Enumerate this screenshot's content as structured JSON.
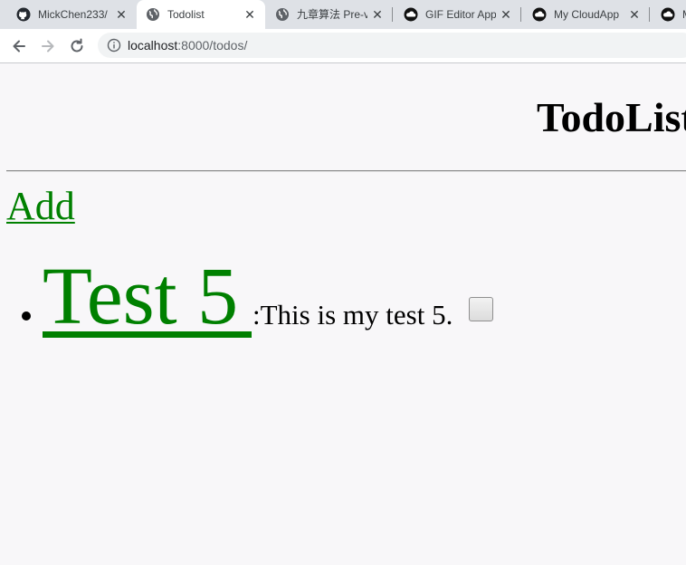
{
  "browser": {
    "tabs": [
      {
        "title": "MickChen233/",
        "icon": "github-icon"
      },
      {
        "title": "Todolist",
        "icon": "globe-icon",
        "active": true
      },
      {
        "title": "九章算法 Pre-v",
        "icon": "globe-icon"
      },
      {
        "title": "GIF Editor App",
        "icon": "cloud-icon"
      },
      {
        "title": "My CloudApp",
        "icon": "cloud-icon"
      },
      {
        "title": "M",
        "icon": "cloud-icon"
      }
    ],
    "url_host": "localhost",
    "url_rest": ":8000/todos/"
  },
  "page": {
    "title": "TodoList",
    "add_label": "Add",
    "todos": [
      {
        "title": "Test 5",
        "description": ":This is my test 5.",
        "done": false
      }
    ]
  },
  "colors": {
    "link": "#008000",
    "page_bg": "#f8f7f9",
    "tabstrip_bg": "#dee1e6"
  }
}
